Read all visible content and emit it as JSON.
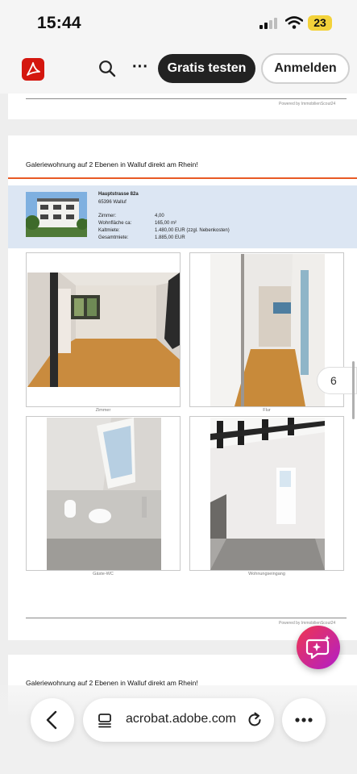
{
  "status_bar": {
    "time": "15:44",
    "battery": "23"
  },
  "toolbar": {
    "try_button": "Gratis testen",
    "login_button": "Anmelden"
  },
  "pages": {
    "powered_by": "Powered by ImmobilienScout24",
    "title": "Galeriewohnung auf 2 Ebenen in Walluf direkt am Rhein!",
    "street": "Hauptstrasse 82a",
    "city": "65396 Walluf",
    "details": [
      {
        "label": "Zimmer:",
        "value": "4,00"
      },
      {
        "label": "Wohnfläche ca:",
        "value": "165,00 m²"
      },
      {
        "label": "Kaltmiete:",
        "value": "1.480,00 EUR (zzgl. Nebenkosten)"
      },
      {
        "label": "Gesamtmiete:",
        "value": "1.885,00 EUR"
      }
    ],
    "photos": [
      {
        "caption": "Zimmer"
      },
      {
        "caption": "Flur"
      },
      {
        "caption": "Gäste-WC"
      },
      {
        "caption": "Wohnungseingang"
      }
    ]
  },
  "page_indicator": "6",
  "browser": {
    "url": "acrobat.adobe.com"
  },
  "colors": {
    "acrobat_red": "#d4170f",
    "header_orange": "#e85a25",
    "info_blue": "#dce6f3",
    "fab_gradient_start": "#f0364f",
    "fab_gradient_end": "#b11ec9"
  }
}
